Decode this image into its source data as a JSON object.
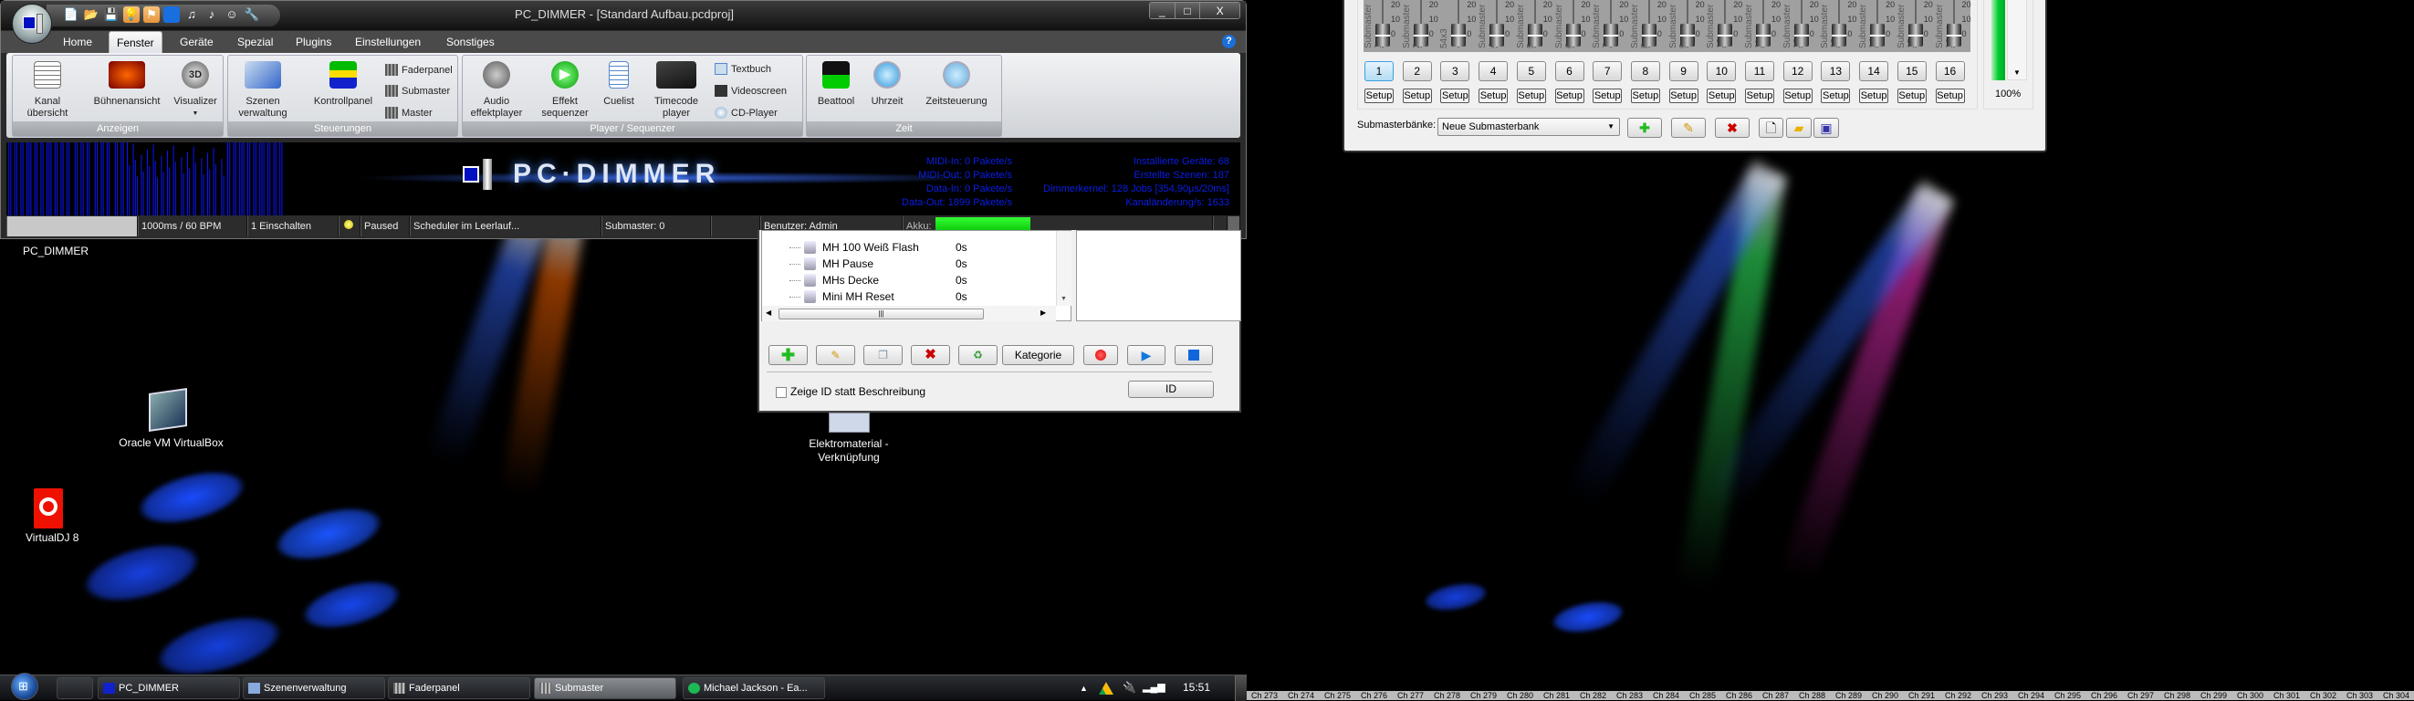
{
  "main_window": {
    "title": "PC_DIMMER - [Standard Aufbau.pcdproj]",
    "window_buttons": [
      "_",
      "□",
      "X"
    ],
    "tabs": [
      {
        "label": "Home"
      },
      {
        "label": "Fenster",
        "active": true
      },
      {
        "label": "Geräte"
      },
      {
        "label": "Spezial"
      },
      {
        "label": "Plugins"
      },
      {
        "label": "Einstellungen"
      },
      {
        "label": "Sonstiges"
      }
    ],
    "help_icon": "?",
    "groups": [
      {
        "label": "Anzeigen"
      },
      {
        "label": "Steuerungen"
      },
      {
        "label": "Player / Sequenzer"
      },
      {
        "label": "Zeit"
      }
    ],
    "buttons": {
      "kanal": "Kanal\nübersicht",
      "buehne": "Bühnenansicht",
      "visualizer": "Visualizer",
      "szenen": "Szenen\nverwaltung",
      "kontrollpanel": "Kontrollpanel",
      "faderpanel": "Faderpanel",
      "submaster": "Submaster",
      "master": "Master",
      "audio": "Audio\neffektplayer",
      "effekt": "Effekt\nsequenzer",
      "cuelist": "Cuelist",
      "timecode": "Timecode\nplayer",
      "textbuch": "Textbuch",
      "videoscreen": "Videoscreen",
      "cdplayer": "CD-Player",
      "beattool": "Beattool",
      "uhrzeit": "Uhrzeit",
      "zeitsteuerung": "Zeitsteuerung"
    },
    "logo_text": "PC·DIMMER",
    "info_left": [
      "MIDI-In: 0 Pakete/s",
      "MIDI-Out: 0 Pakete/s",
      "Data-In: 0 Pakete/s",
      "Data-Out: 1899 Pakete/s"
    ],
    "info_right": [
      "Installierte Geräte: 68",
      "Erstellte Szenen: 187",
      "Dimmerkernel: 128 Jobs [354,90µs/20ms]",
      "Kanaländerung/s: 1633"
    ],
    "info_color": "#0a1ee6",
    "status": {
      "timing": "1000ms / 60 BPM",
      "einschalten": "1 Einschalten",
      "paused": "Paused",
      "scheduler": "Scheduler im Leerlauf...",
      "submaster": "Submaster: 0",
      "user": "Benutzer: Admin",
      "akku_label": "Akku: ",
      "akku_percent": 100
    }
  },
  "scene_window": {
    "rows": [
      {
        "name": "MH 100 Weiß Flash",
        "time": "0s"
      },
      {
        "name": "MH Pause",
        "time": "0s"
      },
      {
        "name": "MHs Decke",
        "time": "0s"
      },
      {
        "name": "Mini MH Reset",
        "time": "0s"
      }
    ],
    "category_button": "Kategorie",
    "show_id_label": "Zeige ID statt Beschreibung",
    "show_id_checked": false,
    "id_button": "ID"
  },
  "desktop_icons": [
    {
      "label": "PC_DIMMER"
    },
    {
      "label": "Oracle VM VirtualBox"
    },
    {
      "label": "VirtualDJ 8"
    },
    {
      "label": "Elektromaterial -\nVerknüpfung"
    }
  ],
  "submaster_window": {
    "faders": [
      {
        "name": "Submaster 1"
      },
      {
        "name": "Submaster 2"
      },
      {
        "name": "54x3"
      },
      {
        "name": "Submaster 4"
      },
      {
        "name": "Submaster 5"
      },
      {
        "name": "Submaster 6"
      },
      {
        "name": "Submaster 7"
      },
      {
        "name": "Submaster 8"
      },
      {
        "name": "Submaster 9"
      },
      {
        "name": "Submaster 10"
      },
      {
        "name": "Submaster 11"
      },
      {
        "name": "Submaster 12"
      },
      {
        "name": "Submaster 13"
      },
      {
        "name": "Submaster 14"
      },
      {
        "name": "Submaster 15"
      },
      {
        "name": "Submaster 16"
      }
    ],
    "scale_ticks": [
      "20",
      "10",
      "0"
    ],
    "numbers": [
      "1",
      "2",
      "3",
      "4",
      "5",
      "6",
      "7",
      "8",
      "9",
      "10",
      "11",
      "12",
      "13",
      "14",
      "15",
      "16"
    ],
    "active_number": "1",
    "setup_label": "Setup",
    "banks_label": "Submasterbänke:",
    "bank_selected": "Neue Submasterbank",
    "master_percent": "100%"
  },
  "taskbar": {
    "items": [
      {
        "label": "PC_DIMMER"
      },
      {
        "label": "Szenenverwaltung"
      },
      {
        "label": "Faderpanel"
      },
      {
        "label": "Submaster",
        "active": true
      },
      {
        "label": "Michael Jackson - Ea..."
      }
    ],
    "clock": "15:51"
  },
  "channel_strip": [
    "Ch 273",
    "Ch 274",
    "Ch 275",
    "Ch 276",
    "Ch 277",
    "Ch 278",
    "Ch 279",
    "Ch 280",
    "Ch 281",
    "Ch 282",
    "Ch 283",
    "Ch 284",
    "Ch 285",
    "Ch 286",
    "Ch 287",
    "Ch 288",
    "Ch 289",
    "Ch 290",
    "Ch 291",
    "Ch 292",
    "Ch 293",
    "Ch 294",
    "Ch 295",
    "Ch 296",
    "Ch 297",
    "Ch 298",
    "Ch 299",
    "Ch 300",
    "Ch 301",
    "Ch 302",
    "Ch 303",
    "Ch 304"
  ]
}
